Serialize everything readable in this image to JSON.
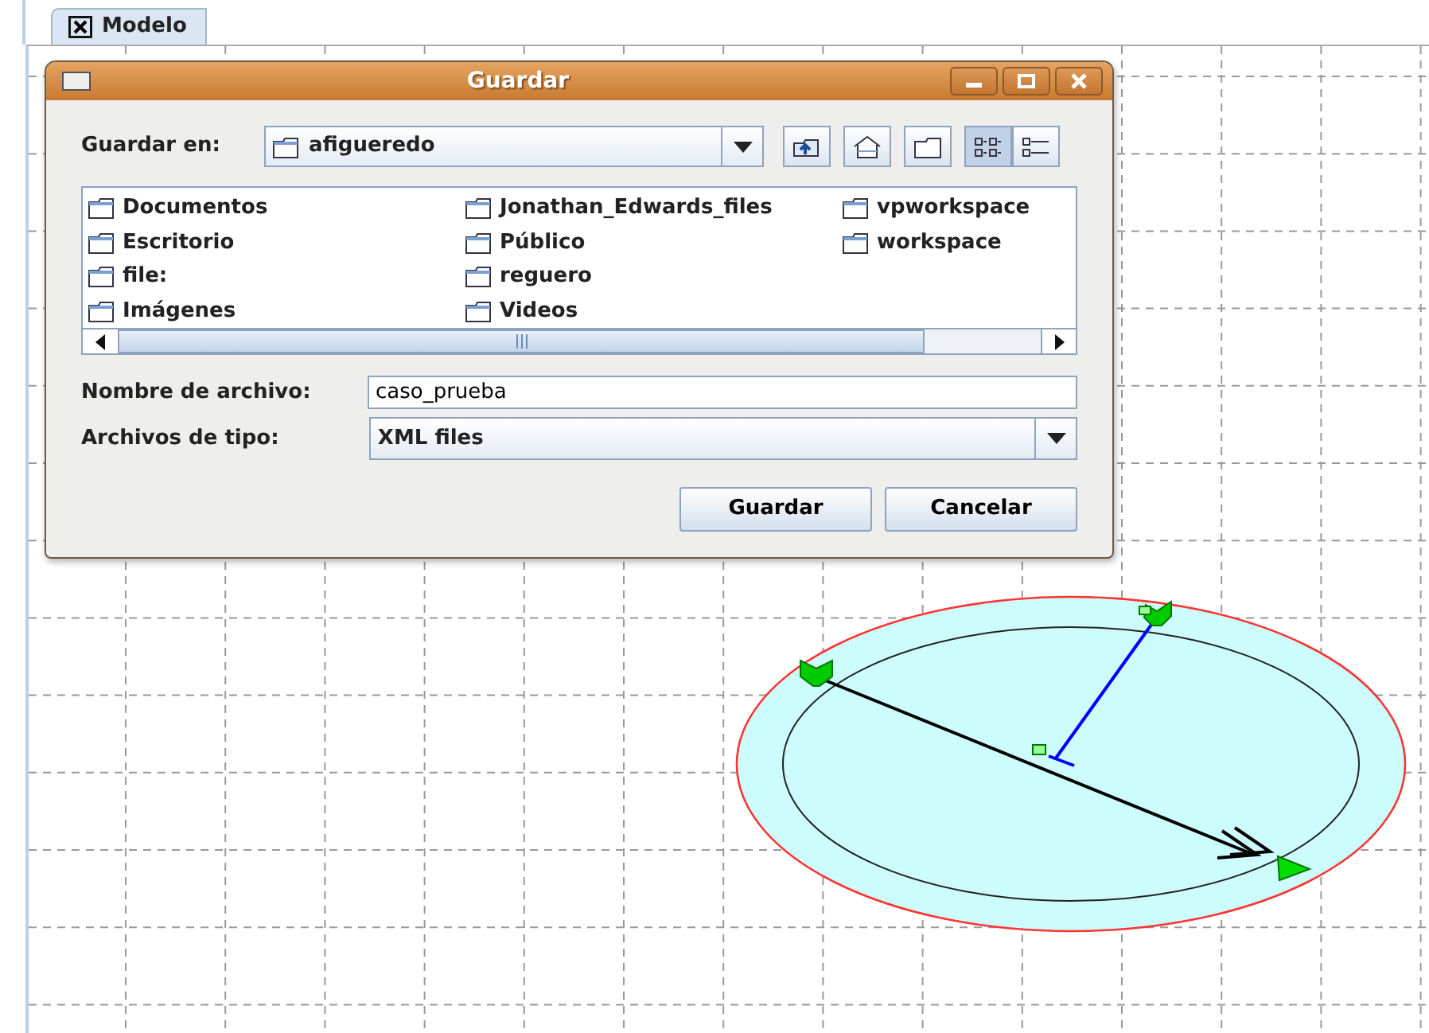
{
  "tab": {
    "label": "Modelo",
    "closable": true
  },
  "dialog": {
    "title": "Guardar",
    "look_in": {
      "label": "Guardar en:",
      "value": "afigueredo"
    },
    "toolbar": [
      {
        "kind": "up",
        "selected": false
      },
      {
        "kind": "home",
        "selected": false
      },
      {
        "kind": "new-folder",
        "selected": false
      },
      {
        "kind": "list",
        "selected": true
      },
      {
        "kind": "details",
        "selected": false
      }
    ],
    "file_columns": [
      [
        "Documentos",
        "Escritorio",
        "file:",
        "Imágenes"
      ],
      [
        "Jonathan_Edwards_files",
        "Público",
        "reguero",
        "Videos"
      ],
      [
        "vpworkspace",
        "workspace"
      ]
    ],
    "file_name": {
      "label": "Nombre de archivo:",
      "value": "caso_prueba"
    },
    "file_type": {
      "label": "Archivos de tipo:",
      "value": "XML files"
    },
    "buttons": [
      "Guardar",
      "Cancelar"
    ]
  }
}
